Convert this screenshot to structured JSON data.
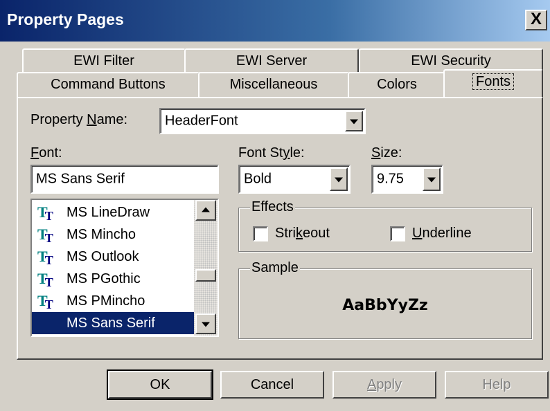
{
  "window": {
    "title": "Property Pages",
    "close_label": "X"
  },
  "tabs": {
    "row1": [
      {
        "label": "EWI Filter"
      },
      {
        "label": "EWI Server"
      },
      {
        "label": "EWI Security"
      }
    ],
    "row2": [
      {
        "label": "Command Buttons"
      },
      {
        "label": "Miscellaneous"
      },
      {
        "label": "Colors"
      },
      {
        "label": "Fonts",
        "active": true
      }
    ]
  },
  "property_name": {
    "label_pre": "Property ",
    "label_accel": "N",
    "label_post": "ame:",
    "value": "HeaderFont"
  },
  "font": {
    "label_accel": "F",
    "label_post": "ont:",
    "value": "MS Sans Serif",
    "list": [
      {
        "name": "MS LineDraw",
        "icon": "truetype-icon"
      },
      {
        "name": "MS Mincho",
        "icon": "truetype-icon"
      },
      {
        "name": "MS Outlook",
        "icon": "truetype-icon"
      },
      {
        "name": "MS PGothic",
        "icon": "truetype-icon"
      },
      {
        "name": "MS PMincho",
        "icon": "truetype-icon"
      },
      {
        "name": "MS Sans Serif",
        "selected": true
      }
    ],
    "truetype_glyph_a": "T",
    "truetype_glyph_b": "T"
  },
  "font_style": {
    "label_pre": "Font St",
    "label_accel": "y",
    "label_post": "le:",
    "value": "Bold"
  },
  "size": {
    "label_accel": "S",
    "label_post": "ize:",
    "value": "9.75"
  },
  "effects": {
    "title": "Effects",
    "strikeout_pre": "Stri",
    "strikeout_accel": "k",
    "strikeout_post": "eout",
    "underline_accel": "U",
    "underline_post": "nderline",
    "strikeout_checked": false,
    "underline_checked": false
  },
  "sample": {
    "title": "Sample",
    "text": "AaBbYyZz"
  },
  "buttons": {
    "ok": "OK",
    "cancel": "Cancel",
    "apply_accel": "A",
    "apply_post": "pply",
    "help": "Help"
  },
  "colors": {
    "face": "#d4d0c8",
    "titlebar": "#0a246a",
    "selection": "#0a246a",
    "truetype_teal": "#008080",
    "truetype_navy": "#000080"
  }
}
